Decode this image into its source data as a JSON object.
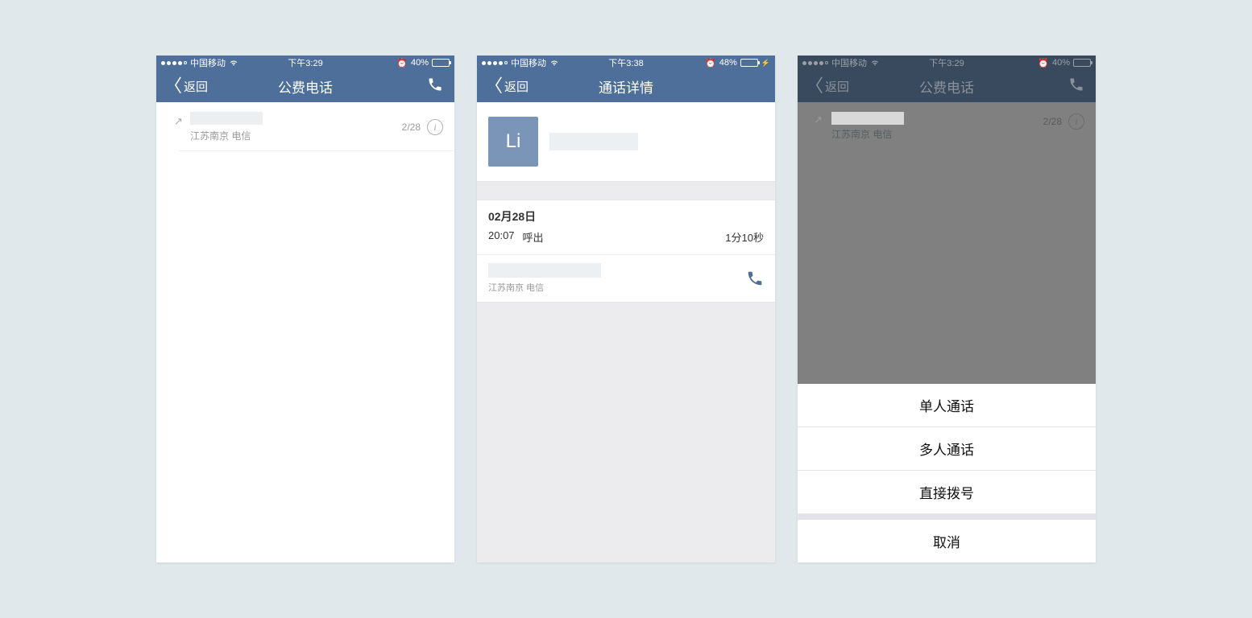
{
  "screen1": {
    "status": {
      "carrier": "中国移动",
      "time": "下午3:29",
      "battery": "40%"
    },
    "nav": {
      "back": "返回",
      "title": "公费电话"
    },
    "call": {
      "location": "江苏南京 电信",
      "date": "2/28"
    }
  },
  "screen2": {
    "status": {
      "carrier": "中国移动",
      "time": "下午3:38",
      "battery": "48%"
    },
    "nav": {
      "back": "返回",
      "title": "通话详情"
    },
    "avatar_initials": "Li",
    "detail": {
      "date": "02月28日",
      "time": "20:07",
      "direction": "呼出",
      "duration": "1分10秒",
      "location": "江苏南京 电信"
    }
  },
  "screen3": {
    "status": {
      "carrier": "中国移动",
      "time": "下午3:29",
      "battery": "40%"
    },
    "nav": {
      "back": "返回",
      "title": "公费电话"
    },
    "call": {
      "location": "江苏南京 电信",
      "date": "2/28"
    },
    "sheet": {
      "opt1": "单人通话",
      "opt2": "多人通话",
      "opt3": "直接拨号",
      "cancel": "取消"
    }
  }
}
